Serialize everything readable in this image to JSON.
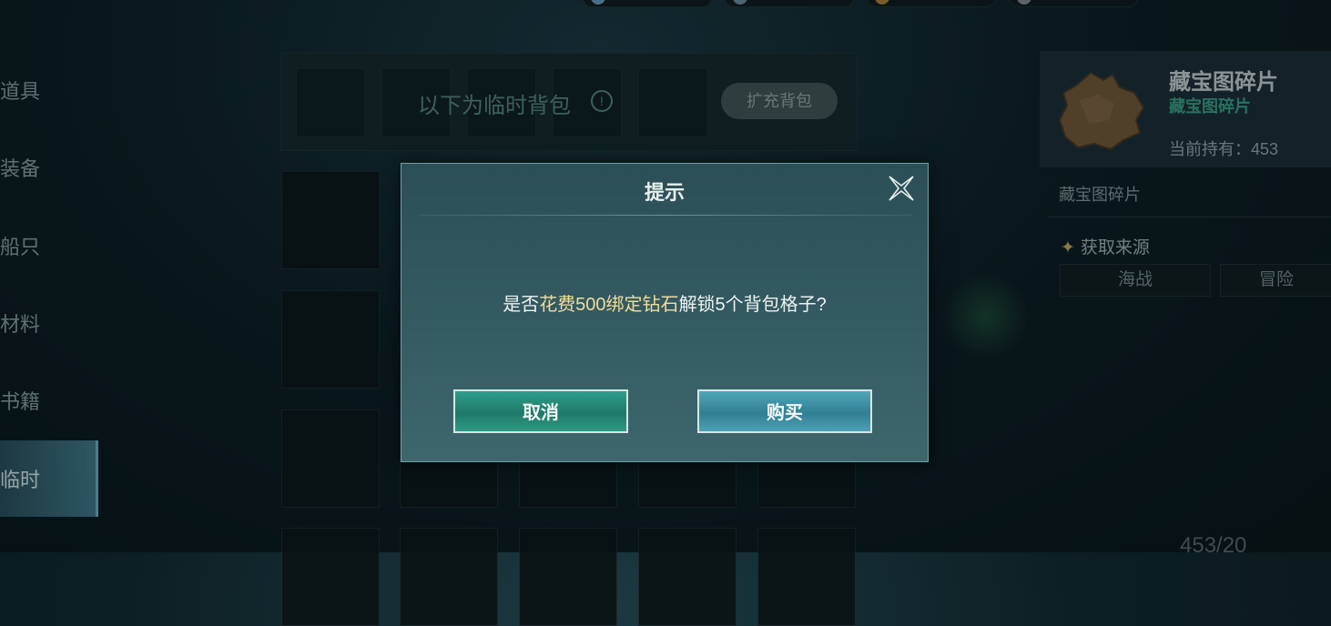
{
  "nav": {
    "items": [
      {
        "label": "道具"
      },
      {
        "label": "装备"
      },
      {
        "label": "船只"
      },
      {
        "label": "材料"
      },
      {
        "label": "书籍"
      },
      {
        "label": "临时"
      }
    ]
  },
  "bag": {
    "title": "以下为临时背包",
    "info_icon": "!",
    "expand_label": "扩充背包"
  },
  "detail": {
    "item_name": "藏宝图碎片",
    "item_subtitle": "藏宝图碎片",
    "hold_text": "当前持有：453",
    "description": "藏宝图碎片",
    "source_title": "获取来源",
    "source_star": "✦",
    "sources": [
      "海战",
      "冒险"
    ],
    "count_text": "453/20"
  },
  "dialog": {
    "title": "提示",
    "msg_prefix": "是否",
    "msg_highlight": "花费500绑定钻石",
    "msg_suffix": "解锁5个背包格子?",
    "cancel_label": "取消",
    "buy_label": "购买"
  },
  "colors": {
    "highlight": "#f0dc9a",
    "accent_green": "#3fa88a",
    "cancel_button": "#1f7968",
    "buy_button": "#327f93"
  }
}
